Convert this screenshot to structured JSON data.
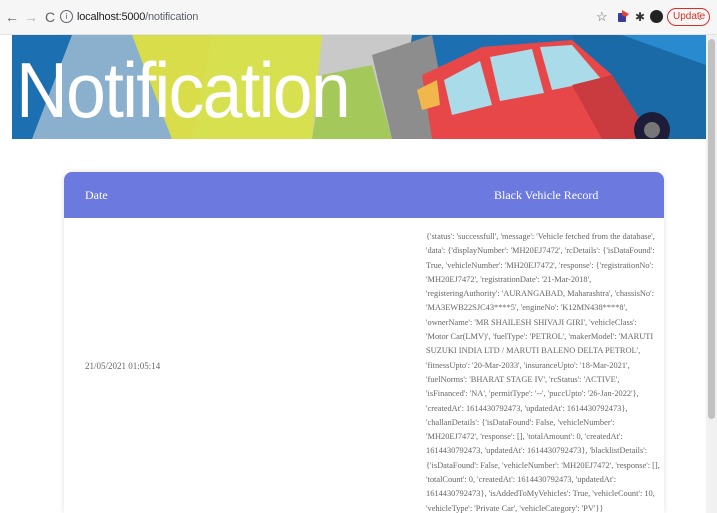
{
  "browser": {
    "url_host": "localhost:5000",
    "url_path": "/notification",
    "update_label": "Update",
    "update_menu": "⋮",
    "back": "←",
    "forward": "→",
    "reload": "C",
    "info": "i",
    "star": "☆",
    "puzzle": "✱"
  },
  "banner": {
    "title": "Notification"
  },
  "table": {
    "headers": {
      "date": "Date",
      "record": "Black Vehicle Record"
    },
    "rows": [
      {
        "date": "21/05/2021 01:05:14",
        "record": "{'status': 'successfull', 'message': 'Vehicle fetched from the database', 'data': {'displayNumber': 'MH20EJ7472', 'rcDetails': {'isDataFound': True, 'vehicleNumber': 'MH20EJ7472', 'response': {'registrationNo': 'MH20EJ7472', 'registrationDate': '21-Mar-2018', 'registeringAuthority': 'AURANGABAD, Maharashtra', 'chassisNo': 'MA3EWB22SJC43****5', 'engineNo': 'K12MN438****8', 'ownerName': 'MR SHAILESH SHIVAJI GIRI', 'vehicleClass': 'Motor Car(LMV)', 'fuelType': 'PETROL', 'makerModel': 'MARUTI SUZUKI INDIA LTD / MARUTI BALENO DELTA PETROL', 'fitnessUpto': '20-Mar-2033', 'insuranceUpto': '18-Mar-2021', 'fuelNorms': 'BHARAT STAGE IV', 'rcStatus': 'ACTIVE', 'isFinanced': 'NA', 'permitType': '--', 'puccUpto': '26-Jan-2022'}, 'createdAt': 1614430792473, 'updatedAt': 1614430792473}, 'challanDetails': {'isDataFound': False, 'vehicleNumber': 'MH20EJ7472', 'response': [], 'totalAmount': 0, 'createdAt': 1614430792473, 'updatedAt': 1614430792473}, 'blacklistDetails': {'isDataFound': False, 'vehicleNumber': 'MH20EJ7472', 'response': [], 'totalCount': 0, 'createdAt': 1614430792473, 'updatedAt': 1614430792473}, 'isAddedToMyVehicles': True, 'vehicleCount': 10, 'vehicleType': 'Private Car', 'vehicleCategory': 'PV'}}"
      }
    ]
  },
  "colors": {
    "header_bg": "#6c7ae0",
    "banner_bg": "#1c6fb0",
    "update_red": "#d93025",
    "car_red": "#e8474a"
  }
}
